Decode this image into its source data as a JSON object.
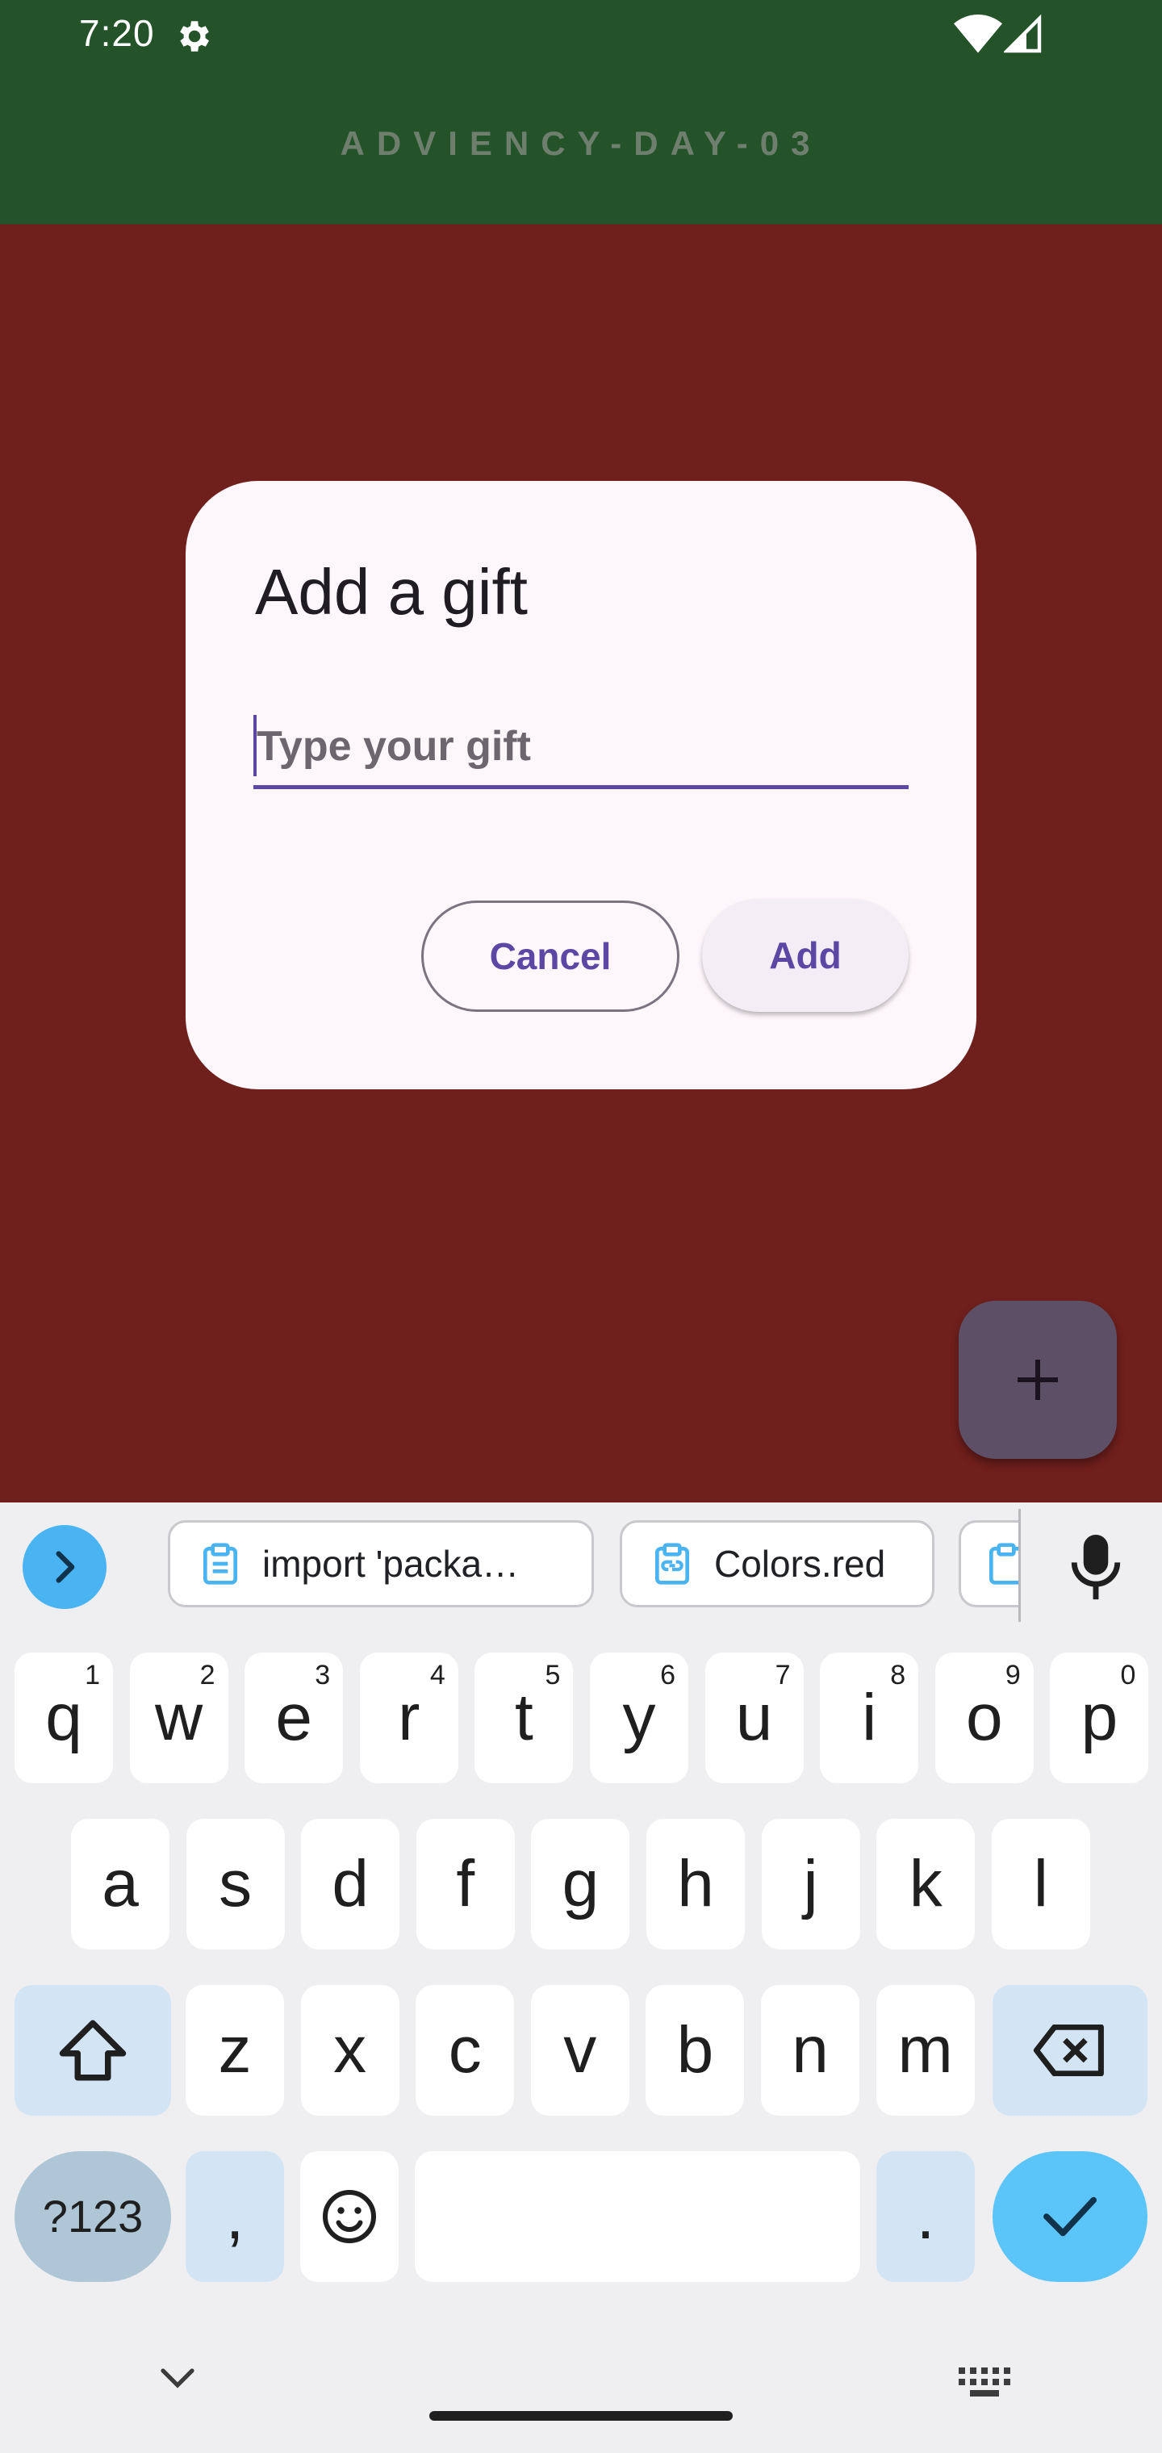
{
  "status_bar": {
    "time": "7:20"
  },
  "app_bar": {
    "title": "ADVIENCY-DAY-03"
  },
  "dialog": {
    "title": "Add a gift",
    "input_placeholder": "Type your gift",
    "input_value": "",
    "cancel_label": "Cancel",
    "add_label": "Add"
  },
  "keyboard": {
    "suggestions": [
      "import 'packa…",
      "Colors.red"
    ],
    "row1": [
      {
        "key": "q",
        "hint": "1"
      },
      {
        "key": "w",
        "hint": "2"
      },
      {
        "key": "e",
        "hint": "3"
      },
      {
        "key": "r",
        "hint": "4"
      },
      {
        "key": "t",
        "hint": "5"
      },
      {
        "key": "y",
        "hint": "6"
      },
      {
        "key": "u",
        "hint": "7"
      },
      {
        "key": "i",
        "hint": "8"
      },
      {
        "key": "o",
        "hint": "9"
      },
      {
        "key": "p",
        "hint": "0"
      }
    ],
    "row2": [
      "a",
      "s",
      "d",
      "f",
      "g",
      "h",
      "j",
      "k",
      "l"
    ],
    "row3": [
      "z",
      "x",
      "c",
      "v",
      "b",
      "n",
      "m"
    ],
    "symbols_label": "?123",
    "comma_label": ",",
    "period_label": "."
  },
  "colors": {
    "app_bar": "#245229",
    "content_background": "#6f1f1c",
    "dialog_background": "#fdf6fb",
    "accent": "#5c48a4",
    "fab": "#5d4f66",
    "keyboard_accent": "#4ab3f2"
  },
  "icons": [
    "settings-gear-icon",
    "wifi-icon",
    "signal-icon",
    "plus-icon",
    "chevron-right-icon",
    "clipboard-icon",
    "clipboard-link-icon",
    "mic-icon",
    "shift-icon",
    "backspace-icon",
    "emoji-icon",
    "check-icon",
    "chevron-down-icon",
    "keyboard-grid-icon"
  ]
}
